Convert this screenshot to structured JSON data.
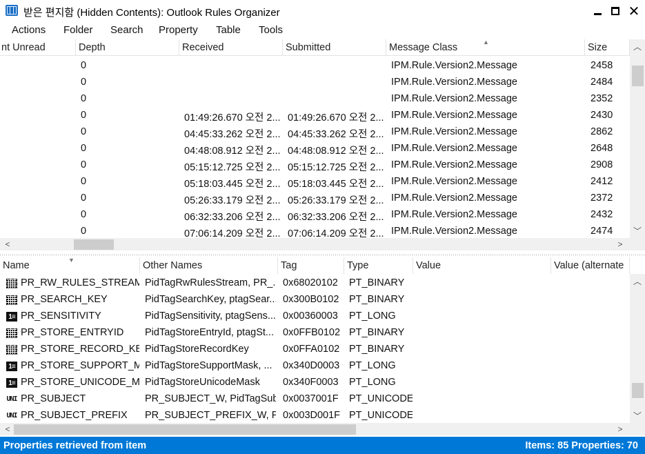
{
  "window": {
    "title": "받은 편지함 (Hidden Contents): Outlook Rules Organizer",
    "min_label": "",
    "max_label": "",
    "close_label": "✕"
  },
  "menu": [
    "Actions",
    "Folder",
    "Search",
    "Property",
    "Table",
    "Tools"
  ],
  "messages": {
    "columns": [
      "nt Unread",
      "Depth",
      "Received",
      "Submitted",
      "Message Class",
      "Size"
    ],
    "rows": [
      {
        "depth": "0",
        "received": "",
        "submitted": "",
        "class": "IPM.Rule.Version2.Message",
        "size": "2458"
      },
      {
        "depth": "0",
        "received": "",
        "submitted": "",
        "class": "IPM.Rule.Version2.Message",
        "size": "2484"
      },
      {
        "depth": "0",
        "received": "",
        "submitted": "",
        "class": "IPM.Rule.Version2.Message",
        "size": "2352"
      },
      {
        "depth": "0",
        "received": "01:49:26.670 오전 2...",
        "submitted": "01:49:26.670 오전 2...",
        "class": "IPM.Rule.Version2.Message",
        "size": "2430"
      },
      {
        "depth": "0",
        "received": "04:45:33.262 오전 2...",
        "submitted": "04:45:33.262 오전 2...",
        "class": "IPM.Rule.Version2.Message",
        "size": "2862"
      },
      {
        "depth": "0",
        "received": "04:48:08.912 오전 2...",
        "submitted": "04:48:08.912 오전 2...",
        "class": "IPM.Rule.Version2.Message",
        "size": "2648"
      },
      {
        "depth": "0",
        "received": "05:15:12.725 오전 2...",
        "submitted": "05:15:12.725 오전 2...",
        "class": "IPM.Rule.Version2.Message",
        "size": "2908"
      },
      {
        "depth": "0",
        "received": "05:18:03.445 오전 2...",
        "submitted": "05:18:03.445 오전 2...",
        "class": "IPM.Rule.Version2.Message",
        "size": "2412"
      },
      {
        "depth": "0",
        "received": "05:26:33.179 오전 2...",
        "submitted": "05:26:33.179 오전 2...",
        "class": "IPM.Rule.Version2.Message",
        "size": "2372"
      },
      {
        "depth": "0",
        "received": "06:32:33.206 오전 2...",
        "submitted": "06:32:33.206 오전 2...",
        "class": "IPM.Rule.Version2.Message",
        "size": "2432"
      },
      {
        "depth": "0",
        "received": "07:06:14.209 오전 2...",
        "submitted": "07:06:14.209 오전 2...",
        "class": "IPM.Rule.Version2.Message",
        "size": "2474"
      }
    ]
  },
  "properties": {
    "columns": [
      "Name",
      "Other Names",
      "Tag",
      "Type",
      "Value",
      "Value (alternate"
    ],
    "rows": [
      {
        "icon": "binary-property-icon",
        "name": "PR_RW_RULES_STREAM",
        "other": "PidTagRwRulesStream, PR_...",
        "tag": "0x68020102",
        "type": "PT_BINARY"
      },
      {
        "icon": "binary-property-icon",
        "name": "PR_SEARCH_KEY",
        "other": "PidTagSearchKey, ptagSear...",
        "tag": "0x300B0102",
        "type": "PT_BINARY"
      },
      {
        "icon": "long-property-icon",
        "name": "PR_SENSITIVITY",
        "other": "PidTagSensitivity, ptagSens...",
        "tag": "0x00360003",
        "type": "PT_LONG"
      },
      {
        "icon": "binary-property-icon",
        "name": "PR_STORE_ENTRYID",
        "other": "PidTagStoreEntryId, ptagSt...",
        "tag": "0x0FFB0102",
        "type": "PT_BINARY"
      },
      {
        "icon": "binary-property-icon",
        "name": "PR_STORE_RECORD_KEY",
        "other": "PidTagStoreRecordKey",
        "tag": "0x0FFA0102",
        "type": "PT_BINARY"
      },
      {
        "icon": "long-property-icon",
        "name": "PR_STORE_SUPPORT_MA...",
        "other": "PidTagStoreSupportMask, ...",
        "tag": "0x340D0003",
        "type": "PT_LONG"
      },
      {
        "icon": "long-property-icon",
        "name": "PR_STORE_UNICODE_M...",
        "other": "PidTagStoreUnicodeMask",
        "tag": "0x340F0003",
        "type": "PT_LONG"
      },
      {
        "icon": "unicode-property-icon",
        "name": "PR_SUBJECT",
        "other": "PR_SUBJECT_W, PidTagSub...",
        "tag": "0x0037001F",
        "type": "PT_UNICODE"
      },
      {
        "icon": "unicode-property-icon",
        "name": "PR_SUBJECT_PREFIX",
        "other": "PR_SUBJECT_PREFIX_W, Pid...",
        "tag": "0x003D001F",
        "type": "PT_UNICODE"
      }
    ]
  },
  "icon_glyphs": {
    "long": "1≡",
    "unicode": "UNI"
  },
  "status": {
    "left": "Properties retrieved from item",
    "right": "Items: 85  Properties: 70"
  },
  "colors": {
    "status_bar": "#0078d7",
    "app_icon": "#1a6fc7"
  }
}
